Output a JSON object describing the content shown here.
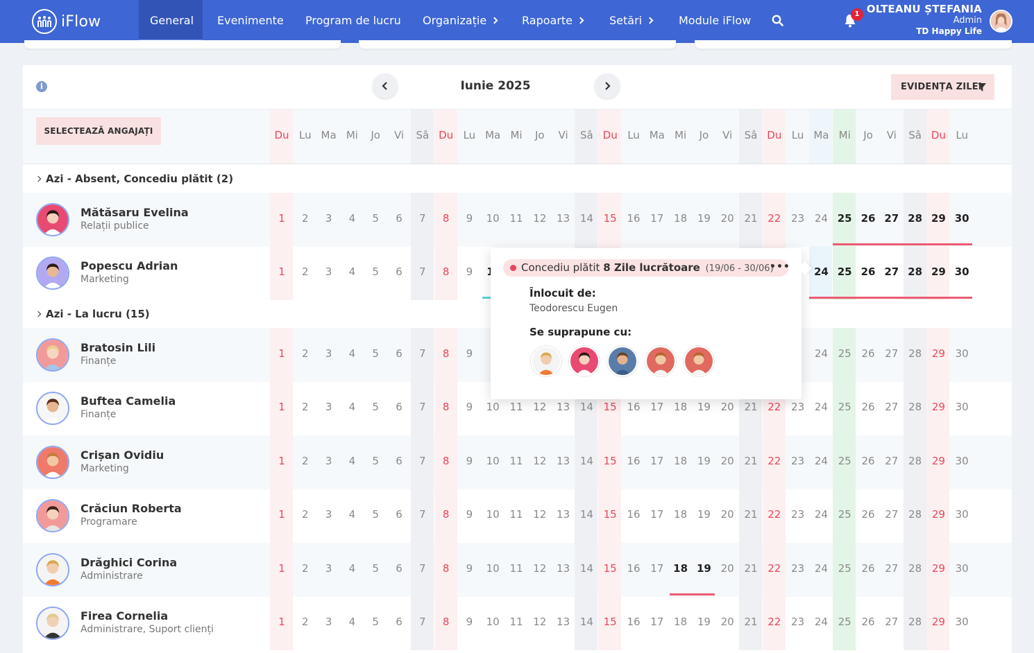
{
  "app": {
    "logo_text": "iFlow"
  },
  "nav": {
    "items": [
      "General",
      "Evenimente",
      "Program de lucru",
      "Organizație",
      "Rapoarte",
      "Setări",
      "Module iFlow"
    ],
    "notifications_count": "1"
  },
  "user": {
    "name": "OLTEANU ȘTEFANIA",
    "role": "Admin",
    "company": "TD Happy Life"
  },
  "calendar": {
    "month": "Iunie 2025",
    "filter_button": "EVIDENȚA ZILEI",
    "select_button": "SELECTEAZĂ ANGAJAȚI",
    "weekdays": [
      "Du",
      "Lu",
      "Ma",
      "Mi",
      "Jo",
      "Vi",
      "Sâ",
      "Du",
      "Lu",
      "Ma",
      "Mi",
      "Jo",
      "Vi",
      "Sâ",
      "Du",
      "Lu",
      "Ma",
      "Mi",
      "Jo",
      "Vi",
      "Sâ",
      "Du",
      "Lu",
      "Ma",
      "Mi",
      "Jo",
      "Vi",
      "Sâ",
      "Du",
      "Lu"
    ],
    "days": [
      "1",
      "2",
      "3",
      "4",
      "5",
      "6",
      "7",
      "8",
      "9",
      "10",
      "11",
      "12",
      "13",
      "14",
      "15",
      "16",
      "17",
      "18",
      "19",
      "20",
      "21",
      "22",
      "23",
      "24",
      "25",
      "26",
      "27",
      "28",
      "29",
      "30"
    ],
    "today": "25"
  },
  "groups": [
    {
      "title": "Azi - Absent, Concediu plătit (2)"
    },
    {
      "title": "Azi - La lucru (15)"
    }
  ],
  "employees": [
    {
      "name": "Mătăsaru Evelina",
      "dept": "Relații publice"
    },
    {
      "name": "Popescu Adrian",
      "dept": "Marketing"
    },
    {
      "name": "Bratosin Lili",
      "dept": "Finanțe"
    },
    {
      "name": "Buftea Camelia",
      "dept": "Finanțe"
    },
    {
      "name": "Crișan Ovidiu",
      "dept": "Marketing"
    },
    {
      "name": "Crăciun Roberta",
      "dept": "Programare"
    },
    {
      "name": "Drăghici Corina",
      "dept": "Administrare"
    },
    {
      "name": "Firea Cornelia",
      "dept": "Administrare, Suport clienți"
    }
  ],
  "popup": {
    "leave_type": "Concediu plătit",
    "leave_days": "8 Zile lucrătoare",
    "leave_range": "(19/06 - 30/06)",
    "more": "•••",
    "replaced_by_label": "Înlocuit de:",
    "replaced_by": "Teodorescu Eugen",
    "overlaps_label": "Se suprapune cu:"
  },
  "colors": {
    "nav": "#3e66d4",
    "accent_red": "#e8475b",
    "today_green": "#e3f5e6"
  }
}
